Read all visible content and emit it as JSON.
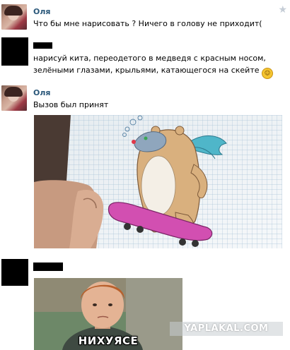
{
  "messages": [
    {
      "author": "Оля",
      "text": "Что бы мне нарисовать ? Ничего в голову не приходит(",
      "avatar": "user-photo"
    },
    {
      "author": "",
      "text": "нарисуй кита, переодетого в медведя с красным носом, зелёными глазами, крыльями, катающегося на скейте",
      "emoji": "smiley-icon",
      "avatar": "censored"
    },
    {
      "author": "Оля",
      "text": "Вызов был принят",
      "avatar": "user-photo"
    },
    {
      "author": "",
      "avatar": "censored"
    }
  ],
  "meme": {
    "caption": "НИХУЯСЕ"
  },
  "watermark": "YAPLAKAL.COM",
  "colors": {
    "author_link": "#2b587a",
    "background": "#ffffff"
  }
}
